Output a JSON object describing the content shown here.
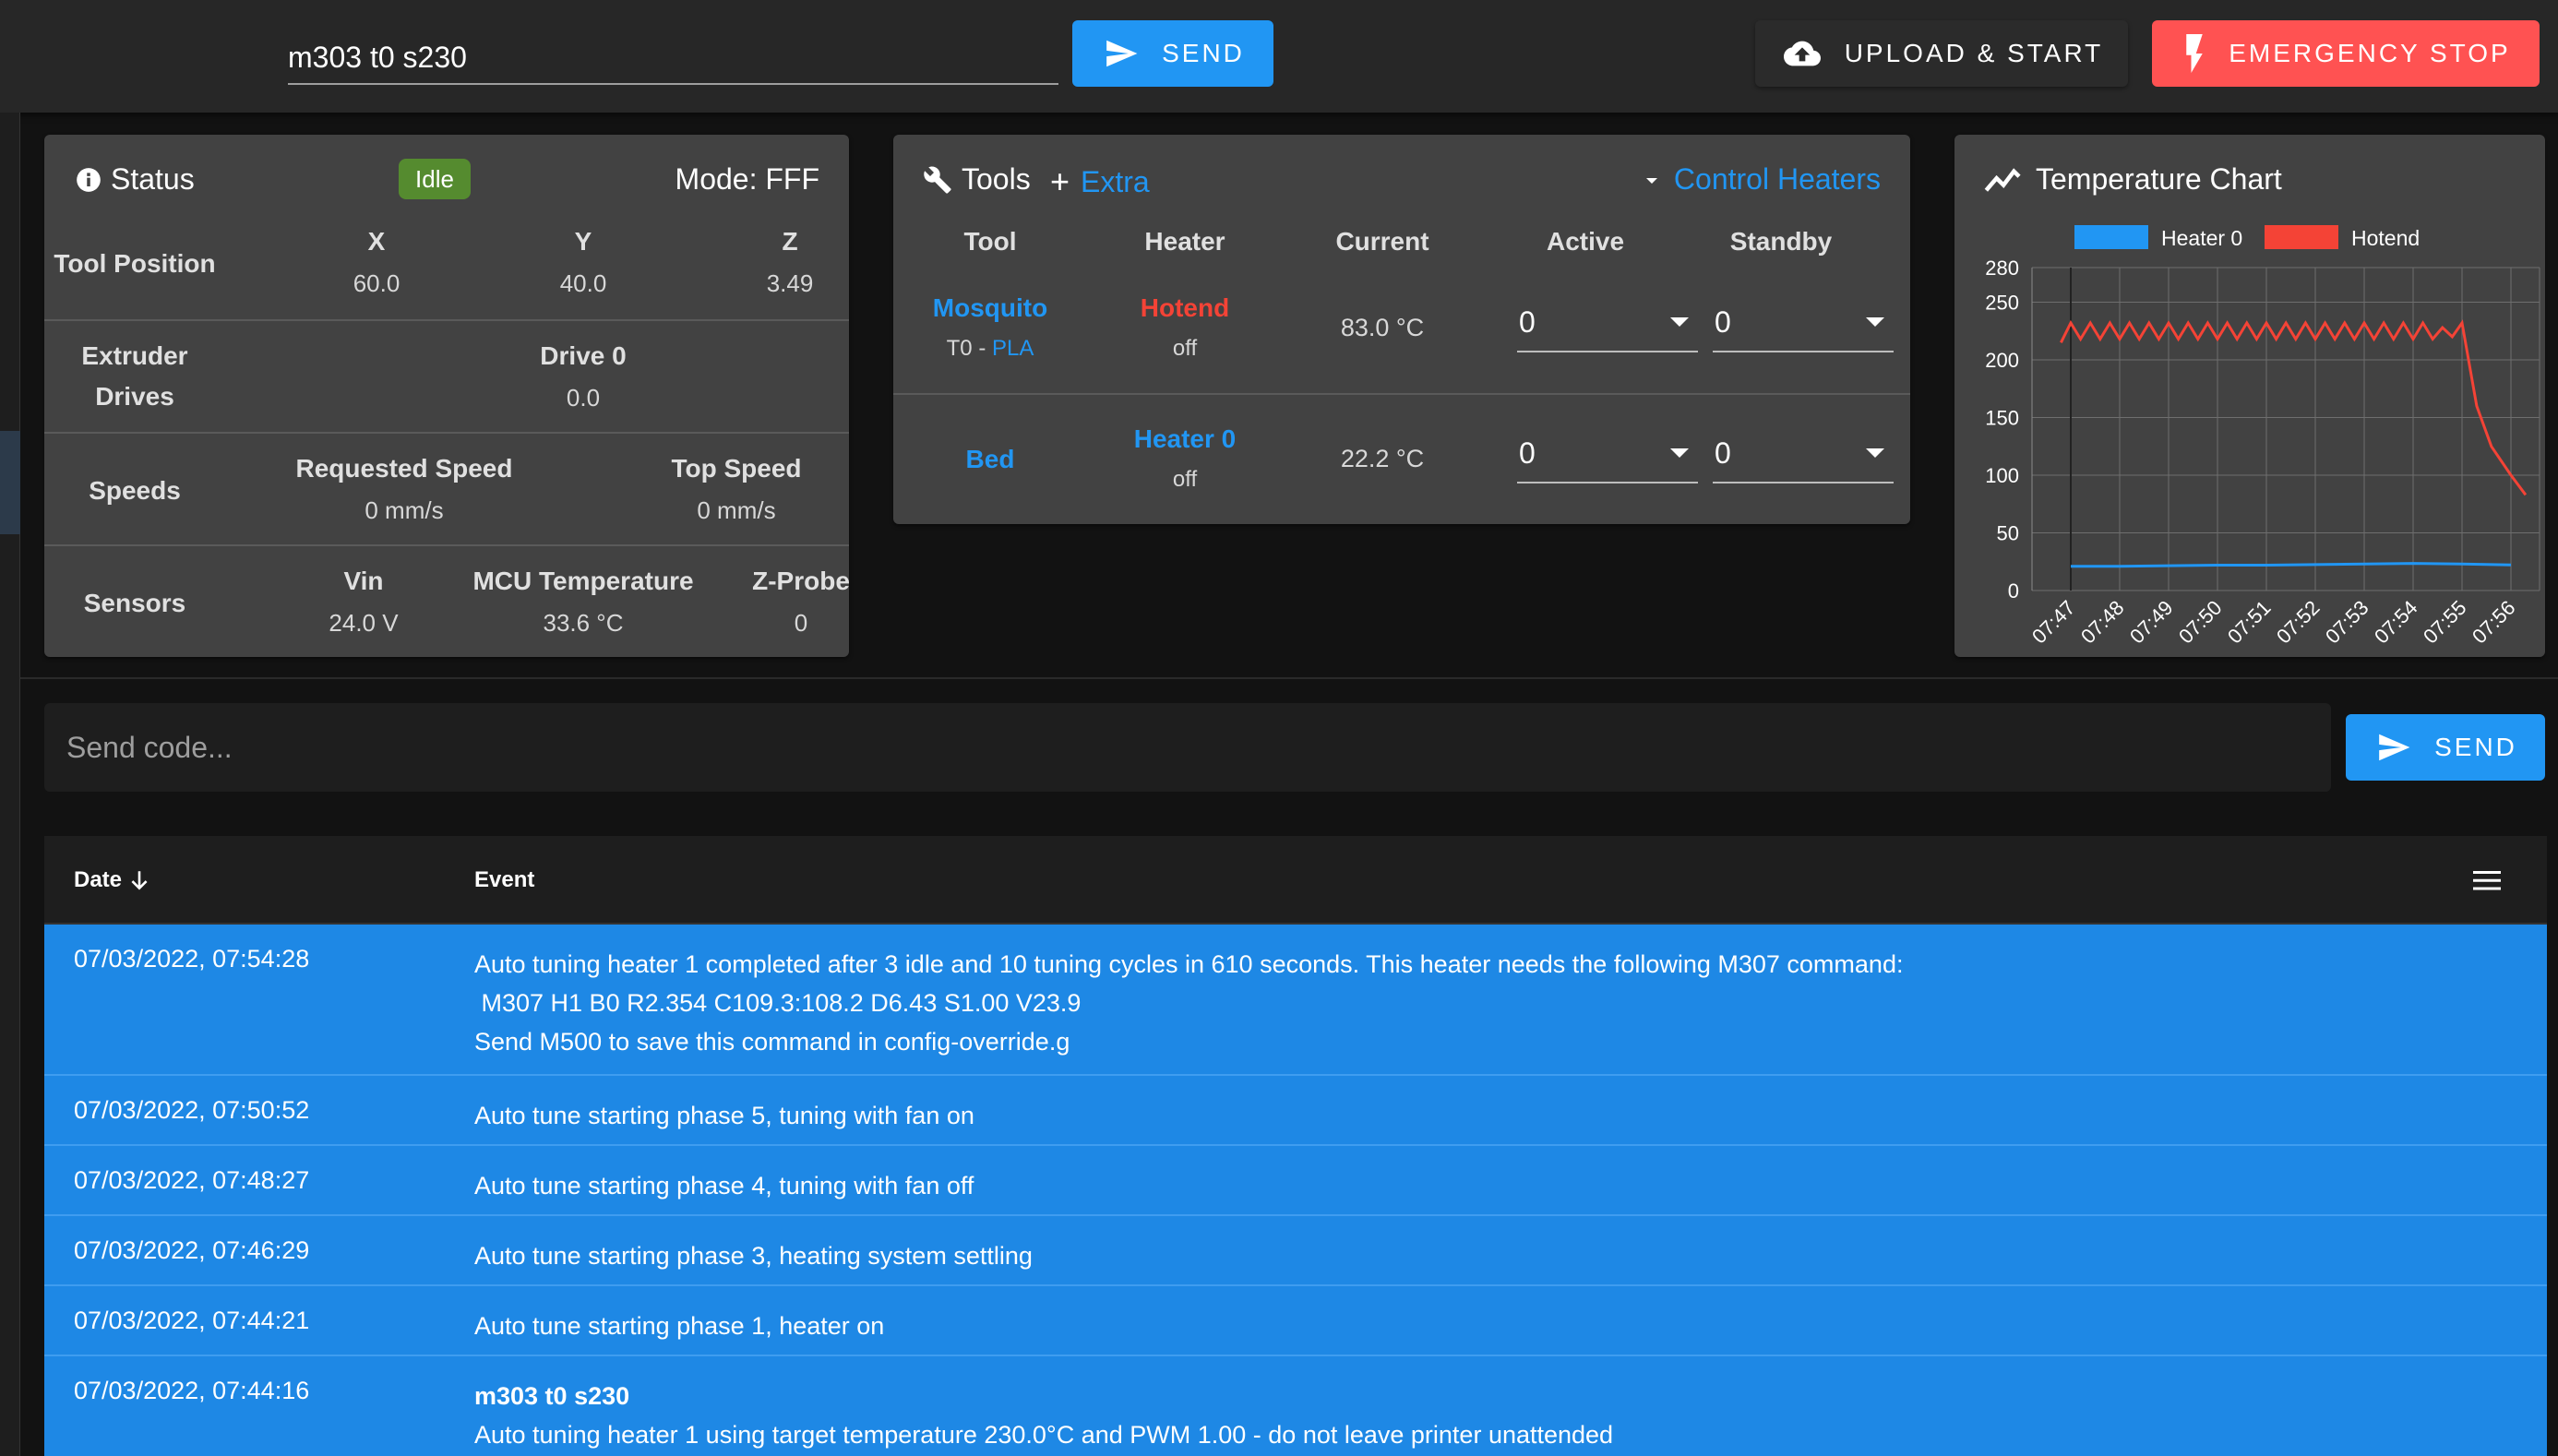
{
  "topbar": {
    "command_value": "m303 t0 s230",
    "send_label": "Send",
    "upload_label": "Upload & Start",
    "estop_label": "Emergency Stop"
  },
  "status": {
    "title": "Status",
    "state": "Idle",
    "mode": "Mode: FFF",
    "tool_position_label": "Tool Position",
    "axes": [
      {
        "name": "X",
        "value": "60.0"
      },
      {
        "name": "Y",
        "value": "40.0"
      },
      {
        "name": "Z",
        "value": "3.49"
      }
    ],
    "extruder_label_1": "Extruder",
    "extruder_label_2": "Drives",
    "drive_name": "Drive 0",
    "drive_value": "0.0",
    "speeds_label": "Speeds",
    "requested_speed_label": "Requested Speed",
    "requested_speed_value": "0 mm/s",
    "top_speed_label": "Top Speed",
    "top_speed_value": "0 mm/s",
    "sensors_label": "Sensors",
    "vin_label": "Vin",
    "vin_value": "24.0 V",
    "mcu_label": "MCU Temperature",
    "mcu_value": "33.6 °C",
    "zprobe_label": "Z-Probe",
    "zprobe_value": "0"
  },
  "tools": {
    "title": "Tools",
    "extra_label": "Extra",
    "control_heaters_label": "Control Heaters",
    "columns": [
      "Tool",
      "Heater",
      "Current",
      "Active",
      "Standby"
    ],
    "rows": [
      {
        "tool": "Mosquito",
        "tool_sub_prefix": "T0 - ",
        "tool_sub_link": "PLA",
        "heater": "Hotend",
        "heater_state": "off",
        "current": "83.0 °C",
        "active": "0",
        "standby": "0"
      },
      {
        "tool": "Bed",
        "heater": "Heater 0",
        "heater_state": "off",
        "current": "22.2 °C",
        "active": "0",
        "standby": "0"
      }
    ]
  },
  "chart": {
    "title": "Temperature Chart"
  },
  "chart_data": {
    "type": "line",
    "title": "Temperature Chart",
    "x": [
      "07:47",
      "07:48",
      "07:49",
      "07:50",
      "07:51",
      "07:52",
      "07:53",
      "07:54",
      "07:55",
      "07:56"
    ],
    "ylim": [
      0,
      280
    ],
    "yticks": [
      0,
      50,
      100,
      150,
      200,
      250,
      280
    ],
    "legend": "top",
    "grid": true,
    "series": [
      {
        "name": "Heater 0",
        "color": "#2196f3",
        "points": [
          [
            0,
            21
          ],
          [
            1,
            21
          ],
          [
            2,
            21.5
          ],
          [
            3,
            22
          ],
          [
            4,
            22
          ],
          [
            5,
            22.5
          ],
          [
            6,
            23
          ],
          [
            7,
            23.5
          ],
          [
            8,
            23
          ],
          [
            9,
            22.2
          ]
        ]
      },
      {
        "name": "Hotend",
        "color": "#f44336",
        "points": [
          [
            -0.2,
            215
          ],
          [
            0,
            232
          ],
          [
            0.2,
            218
          ],
          [
            0.4,
            232
          ],
          [
            0.6,
            218
          ],
          [
            0.8,
            232
          ],
          [
            1,
            218
          ],
          [
            1.2,
            232
          ],
          [
            1.4,
            218
          ],
          [
            1.6,
            232
          ],
          [
            1.8,
            218
          ],
          [
            2,
            232
          ],
          [
            2.2,
            218
          ],
          [
            2.4,
            232
          ],
          [
            2.6,
            218
          ],
          [
            2.8,
            232
          ],
          [
            3,
            218
          ],
          [
            3.2,
            232
          ],
          [
            3.4,
            218
          ],
          [
            3.6,
            232
          ],
          [
            3.8,
            218
          ],
          [
            4,
            232
          ],
          [
            4.2,
            218
          ],
          [
            4.4,
            232
          ],
          [
            4.6,
            218
          ],
          [
            4.8,
            232
          ],
          [
            5,
            218
          ],
          [
            5.2,
            232
          ],
          [
            5.4,
            218
          ],
          [
            5.6,
            232
          ],
          [
            5.8,
            218
          ],
          [
            6,
            232
          ],
          [
            6.2,
            218
          ],
          [
            6.4,
            232
          ],
          [
            6.6,
            218
          ],
          [
            6.8,
            232
          ],
          [
            7,
            218
          ],
          [
            7.2,
            232
          ],
          [
            7.4,
            218
          ],
          [
            7.6,
            228
          ],
          [
            7.8,
            220
          ],
          [
            8.0,
            232
          ],
          [
            8.3,
            160
          ],
          [
            8.6,
            125
          ],
          [
            9,
            100
          ],
          [
            9.3,
            83
          ]
        ]
      }
    ]
  },
  "console": {
    "placeholder": "Send code...",
    "send_label": "Send"
  },
  "events": {
    "col_date": "Date",
    "col_event": "Event",
    "rows": [
      {
        "date": "07/03/2022, 07:54:28",
        "lines": [
          "Auto tuning heater 1 completed after 3 idle and 10 tuning cycles in 610 seconds. This heater needs the following M307 command:",
          " M307 H1 B0 R2.354 C109.3:108.2 D6.43 S1.00 V23.9",
          "Send M500 to save this command in config-override.g"
        ]
      },
      {
        "date": "07/03/2022, 07:50:52",
        "lines": [
          "Auto tune starting phase 5, tuning with fan on"
        ]
      },
      {
        "date": "07/03/2022, 07:48:27",
        "lines": [
          "Auto tune starting phase 4, tuning with fan off"
        ]
      },
      {
        "date": "07/03/2022, 07:46:29",
        "lines": [
          "Auto tune starting phase 3, heating system settling"
        ]
      },
      {
        "date": "07/03/2022, 07:44:21",
        "lines": [
          "Auto tune starting phase 1, heater on"
        ]
      },
      {
        "date": "07/03/2022, 07:44:16",
        "title": "m303 t0 s230",
        "lines": [
          "Auto tuning heater 1 using target temperature 230.0°C and PWM 1.00 - do not leave printer unattended"
        ]
      }
    ]
  }
}
